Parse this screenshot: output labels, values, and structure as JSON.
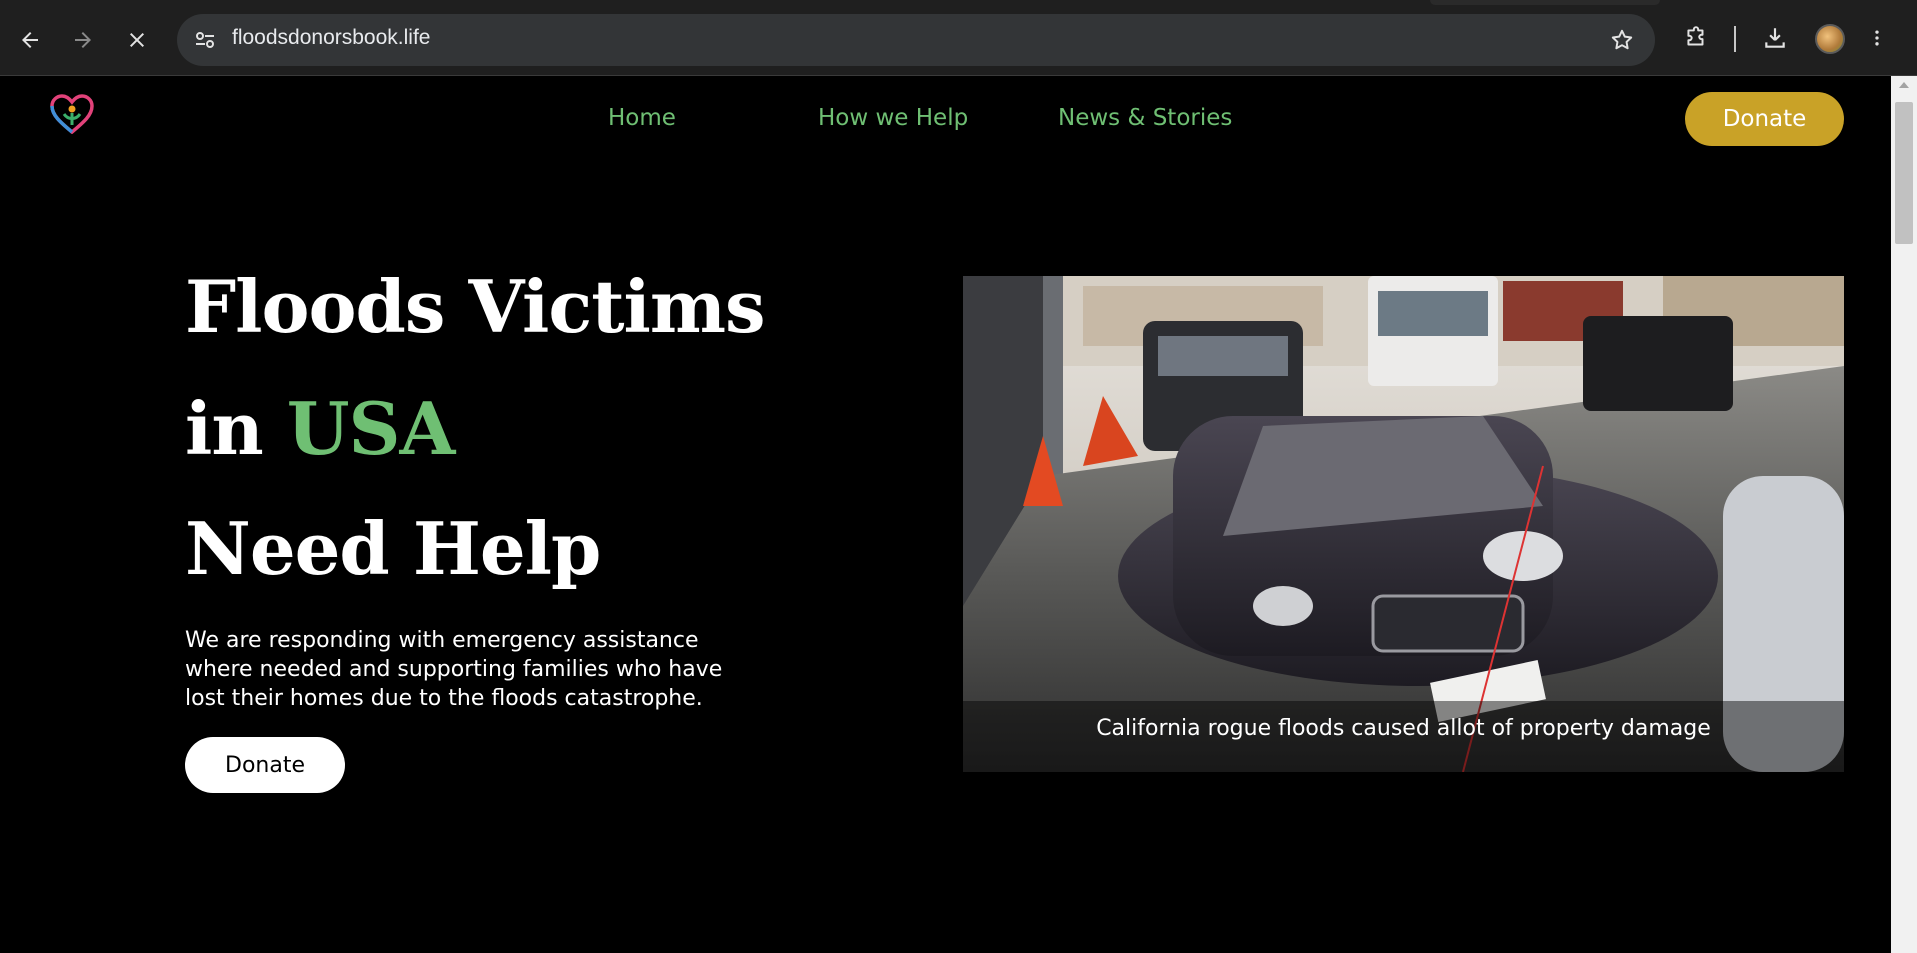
{
  "browser": {
    "url": "floodsdonorsbook.life"
  },
  "nav": {
    "links": [
      "Home",
      "How we Help",
      "News & Stories"
    ],
    "donate_label": "Donate"
  },
  "hero": {
    "line1": "Floods Victims",
    "line2_prefix": "in ",
    "line2_accent": "USA",
    "line3": "Need Help",
    "description": "We are responding with emergency assistance where needed and supporting families who have lost their homes due to the floods catastrophe.",
    "donate_label": "Donate",
    "image_caption": "California rogue floods caused allot of property damage"
  },
  "colors": {
    "accent_green": "#6fbf73",
    "donate_gold": "#c9a227",
    "background": "#000000"
  }
}
